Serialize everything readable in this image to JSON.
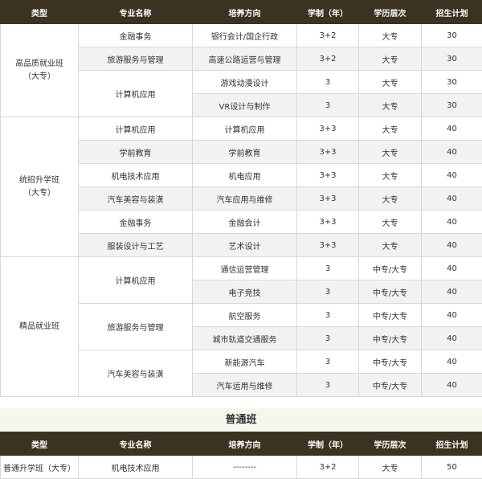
{
  "header": [
    "类型",
    "专业名称",
    "培养方向",
    "学制（年）",
    "学历层次",
    "招生计划"
  ],
  "groups": [
    {
      "category": [
        "高品质就业班",
        "（大专）"
      ],
      "majors": [
        {
          "name": "金融事务",
          "rows": [
            [
              "银行会计/国企行政",
              "3+2",
              "大专",
              "30"
            ]
          ]
        },
        {
          "name": "旅游服务与管理",
          "rows": [
            [
              "高速公路运营与管理",
              "3+2",
              "大专",
              "30"
            ]
          ]
        },
        {
          "name": "计算机应用",
          "rows": [
            [
              "游戏动漫设计",
              "3",
              "大专",
              "30"
            ],
            [
              "VR设计与制作",
              "3",
              "大专",
              "30"
            ]
          ]
        }
      ]
    },
    {
      "category": [
        "统招升学班",
        "（大专）"
      ],
      "majors": [
        {
          "name": "计算机应用",
          "rows": [
            [
              "计算机应用",
              "3+3",
              "大专",
              "40"
            ]
          ]
        },
        {
          "name": "学前教育",
          "rows": [
            [
              "学前教育",
              "3+3",
              "大专",
              "40"
            ]
          ]
        },
        {
          "name": "机电技术应用",
          "rows": [
            [
              "机电应用",
              "3+3",
              "大专",
              "40"
            ]
          ]
        },
        {
          "name": "汽车美容与装潢",
          "rows": [
            [
              "汽车应用与维修",
              "3+3",
              "大专",
              "40"
            ]
          ]
        },
        {
          "name": "金融事务",
          "rows": [
            [
              "金融会计",
              "3+3",
              "大专",
              "40"
            ]
          ]
        },
        {
          "name": "服装设计与工艺",
          "rows": [
            [
              "艺术设计",
              "3+3",
              "大专",
              "40"
            ]
          ]
        }
      ]
    },
    {
      "category": [
        "精品就业班"
      ],
      "majors": [
        {
          "name": "计算机应用",
          "rows": [
            [
              "通信运营管理",
              "3",
              "中专/大专",
              "40"
            ],
            [
              "电子竞技",
              "3",
              "中专/大专",
              "40"
            ]
          ]
        },
        {
          "name": "旅游服务与管理",
          "rows": [
            [
              "航空服务",
              "3",
              "中专/大专",
              "40"
            ],
            [
              "城市轨道交通服务",
              "3",
              "中专/大专",
              "40"
            ]
          ]
        },
        {
          "name": "汽车美容与装潢",
          "rows": [
            [
              "新能源汽车",
              "3",
              "中专/大专",
              "40"
            ],
            [
              "汽车运用与维修",
              "3",
              "中专/大专",
              "40"
            ]
          ]
        }
      ]
    }
  ],
  "section2": {
    "title": "普通班",
    "header": [
      "类型",
      "专业名称",
      "培养方向",
      "学制（年）",
      "学历层次",
      "招生计划"
    ],
    "rows": [
      [
        "普通升学班（大专）",
        "机电技术应用",
        "--------",
        "3+2",
        "大专",
        "50"
      ]
    ]
  }
}
